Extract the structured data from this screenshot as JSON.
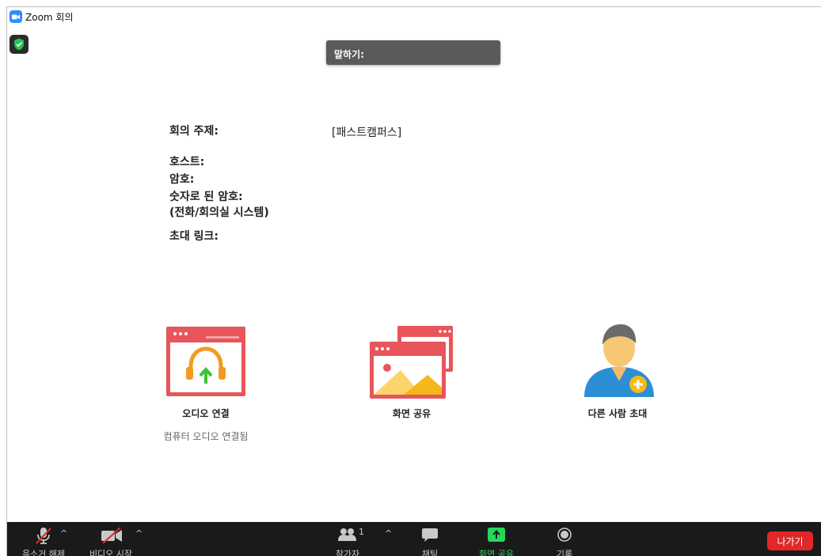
{
  "window": {
    "title": "Zoom 회의"
  },
  "speaking_banner": {
    "label": "말하기:"
  },
  "meeting_info": {
    "topic_label": "회의 주제:",
    "topic_value": "[패스트캠퍼스]",
    "host_label": "호스트:",
    "password_label": "암호:",
    "numeric_password_label": "숫자로 된 암호:",
    "numeric_password_sub": "(전화/회의실 시스템)",
    "invite_link_label": "초대 링크:"
  },
  "options": {
    "audio": {
      "label": "오디오 연결",
      "status": "컴퓨터 오디오 연결됨",
      "icon": "headphones-upload-icon"
    },
    "share": {
      "label": "화면 공유",
      "icon": "share-screen-windows-icon"
    },
    "invite": {
      "label": "다른 사람 초대",
      "icon": "person-add-icon"
    }
  },
  "toolbar": {
    "unmute": "음소거 해제",
    "start_video": "비디오 시작",
    "participants": "참가자",
    "participants_count": "1",
    "chat": "채팅",
    "share_screen": "화면 공유",
    "record": "기록",
    "leave": "나가기"
  },
  "colors": {
    "accent_red": "#e8555a",
    "share_green": "#23d959",
    "leave_red": "#e02828",
    "toolbar_bg": "#1a1a1a",
    "zoom_blue": "#2d8cff"
  }
}
